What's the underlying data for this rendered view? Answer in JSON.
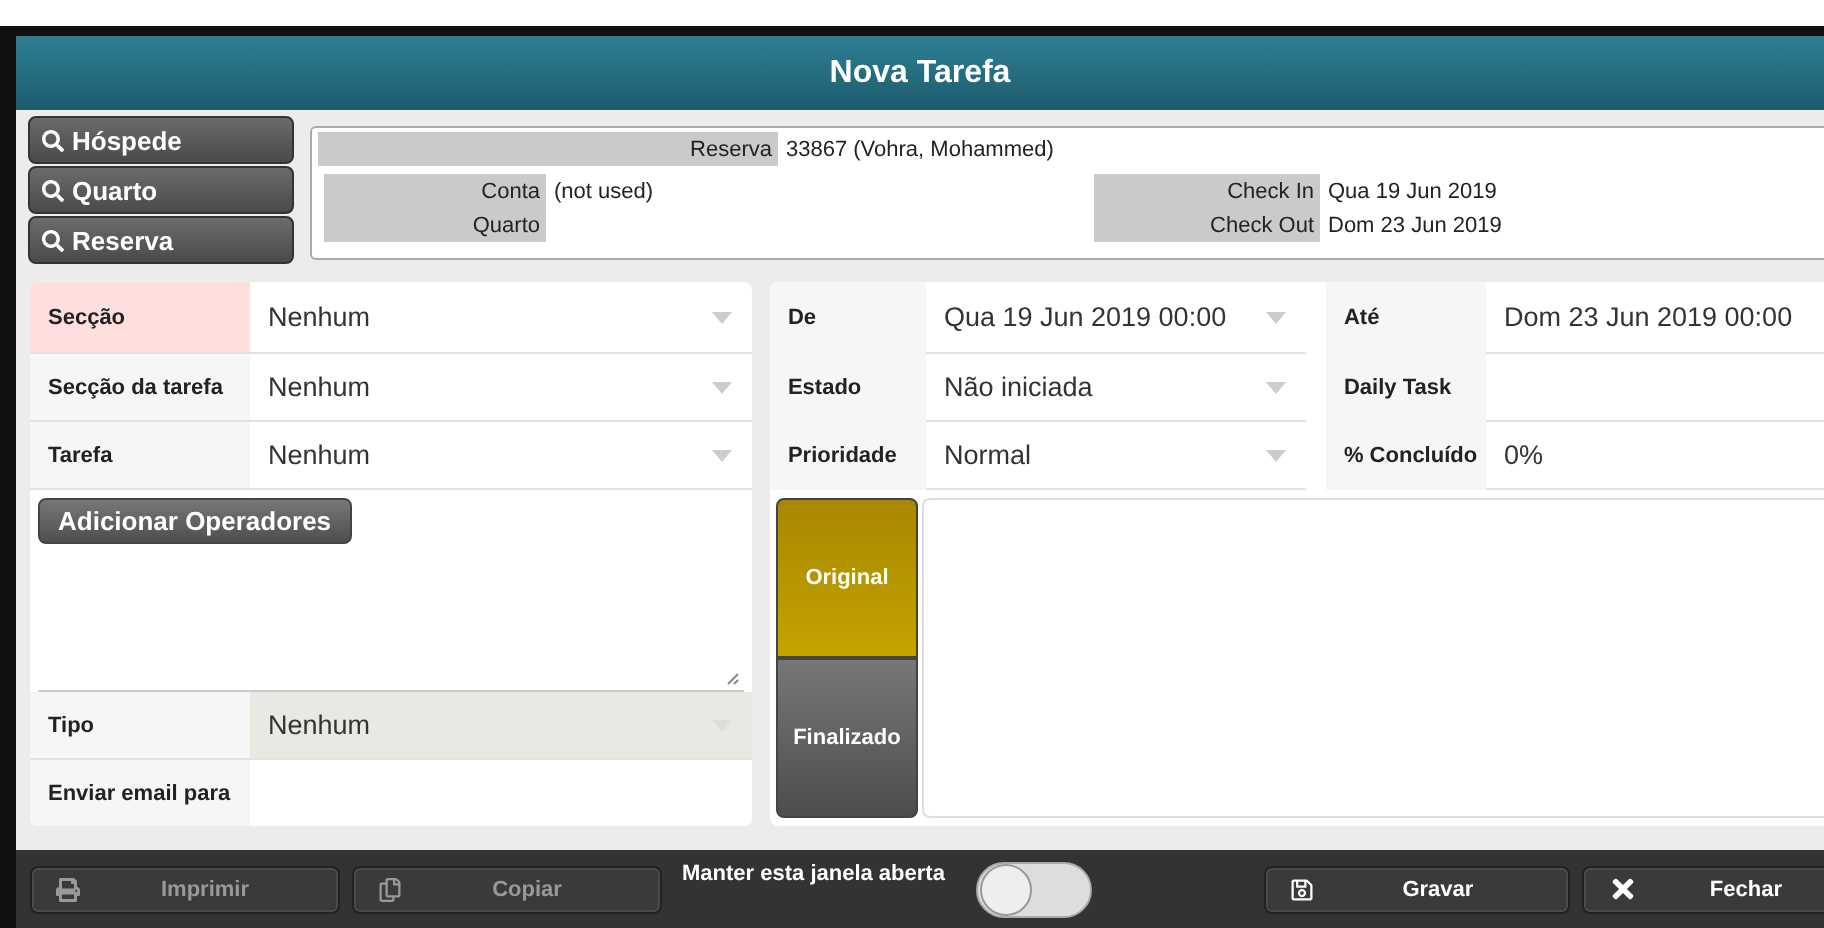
{
  "window": {
    "title": "Nova Tarefa"
  },
  "lookup_buttons": [
    {
      "label": "Hóspede"
    },
    {
      "label": "Quarto"
    },
    {
      "label": "Reserva"
    }
  ],
  "info": {
    "reserva": {
      "label": "Reserva",
      "value": "33867 (Vohra, Mohammed)"
    },
    "left": [
      {
        "label": "Conta",
        "value": "(not used)"
      },
      {
        "label": "Quarto"
      }
    ],
    "right": [
      {
        "label": "Check In",
        "value": "Qua 19 Jun 2019"
      },
      {
        "label": "Check Out",
        "value": "Dom 23 Jun 2019"
      }
    ]
  },
  "left_form": {
    "rows": [
      {
        "label": "Secção",
        "value": "Nenhum",
        "invalid": true
      },
      {
        "label": "Secção da tarefa",
        "value": "Nenhum",
        "invalid": false
      },
      {
        "label": "Tarefa",
        "value": "Nenhum",
        "invalid": false
      }
    ],
    "operators_button": "Adicionar Operadores",
    "tipo": {
      "label": "Tipo",
      "value": "Nenhum",
      "disabled": true
    },
    "email": {
      "label": "Enviar email para"
    }
  },
  "right_form": {
    "rows": [
      [
        {
          "label": "De",
          "value": "Qua 19 Jun 2019 00:00",
          "dropdown": true
        },
        {
          "label": "Até",
          "value": "Dom 23 Jun 2019 00:00",
          "dropdown": false
        }
      ],
      [
        {
          "label": "Estado",
          "value": "Não iniciada",
          "dropdown": true
        },
        {
          "label": "Daily Task",
          "dropdown": false
        }
      ],
      [
        {
          "label": "Prioridade",
          "value": "Normal",
          "dropdown": true
        },
        {
          "label": "% Concluído",
          "value": "0%",
          "dropdown": false
        }
      ]
    ],
    "tabs": [
      {
        "label": "Original",
        "selected": true
      },
      {
        "label": "Finalizado",
        "selected": false
      }
    ]
  },
  "footer": {
    "buttons_left": [
      {
        "label": "Imprimir",
        "disabled": true
      },
      {
        "label": "Copiar",
        "disabled": true
      }
    ],
    "keep_open": {
      "label": "Manter esta janela aberta",
      "on": false
    },
    "buttons_right": [
      {
        "label": "Gravar",
        "disabled": false
      },
      {
        "label": "Fechar",
        "disabled": false
      }
    ]
  }
}
